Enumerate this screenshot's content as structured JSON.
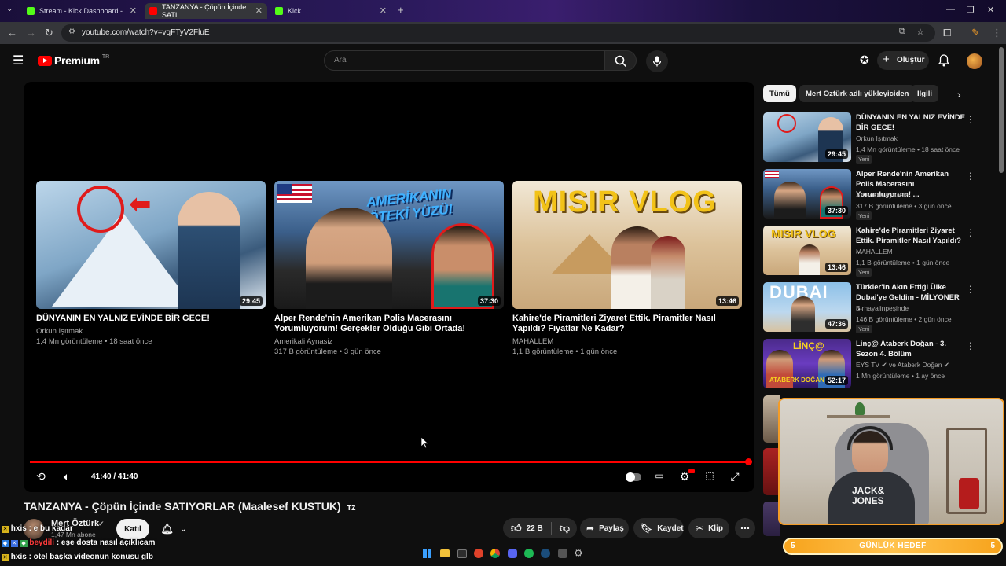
{
  "browser": {
    "tabs": [
      {
        "label": "Stream - Kick Dashboard -",
        "active": false
      },
      {
        "label": "TANZANYA - Çöpün İçinde SATI",
        "active": true
      },
      {
        "label": "Kick",
        "active": false
      }
    ],
    "url": "youtube.com/watch?v=vqFTyV2FluE"
  },
  "header": {
    "logo_label": "Premium",
    "logo_badge": "TR",
    "search_placeholder": "Ara",
    "create_label": "Oluştur"
  },
  "player": {
    "time": "41:40 / 41:40",
    "progress_fraction": 1.0,
    "endcards": [
      {
        "title": "DÜNYANIN EN YALNIZ EVİNDE BİR GECE!",
        "channel": "Orkun Işıtmak",
        "stats": "1,4 Mn görüntüleme • 18 saat önce",
        "duration": "29:45"
      },
      {
        "title": "Alper Rende'nin Amerikan Polis Macerasını Yorumluyorum! Gerçekler Olduğu Gibi Ortada!",
        "channel": "Amerikali Aynasiz",
        "stats": "317 B görüntüleme • 3 gün önce",
        "duration": "37:30"
      },
      {
        "title": "Kahire'de Piramitleri Ziyaret Ettik. Piramitler Nasıl Yapıldı? Fiyatlar Ne Kadar?",
        "channel": "MAHALLEM",
        "stats": "1,1 B görüntüleme • 1 gün önce",
        "duration": "13:46"
      }
    ]
  },
  "video": {
    "title": "TANZANYA - Çöpün İçinde SATIYORLAR (Maalesef KUSTUK)",
    "title_suffix": "ᴛᴢ",
    "channel": "Mert Öztürk",
    "subscribers": "1,47 Mn abone",
    "join_label": "Katıl",
    "like_count": "22 B",
    "share_label": "Paylaş",
    "save_label": "Kaydet",
    "clip_label": "Klip"
  },
  "sidebar": {
    "chips": [
      "Tümü",
      "Mert Öztürk adlı yükleyiciden",
      "İlgili"
    ],
    "items": [
      {
        "title": "DÜNYANIN EN YALNIZ EVİNDE BİR GECE!",
        "channel": "Orkun Işıtmak",
        "stats": "1,4 Mn görüntüleme • 18 saat önce",
        "duration": "29:45",
        "badge": "Yeni"
      },
      {
        "title": "Alper Rende'nin Amerikan Polis Macerasını Yorumluyorum! ...",
        "channel": "Amerikali Aynasiz",
        "stats": "317 B görüntüleme • 3 gün önce",
        "duration": "37:30",
        "badge": "Yeni"
      },
      {
        "title": "Kahire'de Piramitleri Ziyaret Ettik. Piramitler Nasıl Yapıldı? ...",
        "channel": "MAHALLEM",
        "stats": "1,1 B görüntüleme • 1 gün önce",
        "duration": "13:46",
        "badge": "Yeni"
      },
      {
        "title": "Türkler'in Akın Ettiği Ülke Dubai'ye Geldim - MİLYONER ...",
        "channel": "Birhayalinpeşinde",
        "stats": "146 B görüntüleme • 2 gün önce",
        "duration": "47:36",
        "badge": "Yeni"
      },
      {
        "title": "Linç@ Ataberk Doğan - 3. Sezon 4. Bölüm",
        "channel": "EYS TV",
        "channel2": "ve Ataberk Doğan",
        "stats": "1 Mn görüntüleme • 1 ay önce",
        "duration": "52:17",
        "badge": ""
      }
    ]
  },
  "overlay": {
    "goal_label": "GÜNLÜK HEDEF",
    "goal_left": "5",
    "goal_right": "5",
    "chat": [
      {
        "user": "hxis",
        "text": ": e bu kadar"
      },
      {
        "user": "beydili",
        "text": ": eşe dosta nasıl açıklıcam"
      },
      {
        "user": "hxis",
        "text": ": otel başka videonun konusu glb"
      }
    ]
  },
  "colors": {
    "accent": "#ff0000",
    "goal": "#f7a31c",
    "bg": "#0f0f0f"
  }
}
